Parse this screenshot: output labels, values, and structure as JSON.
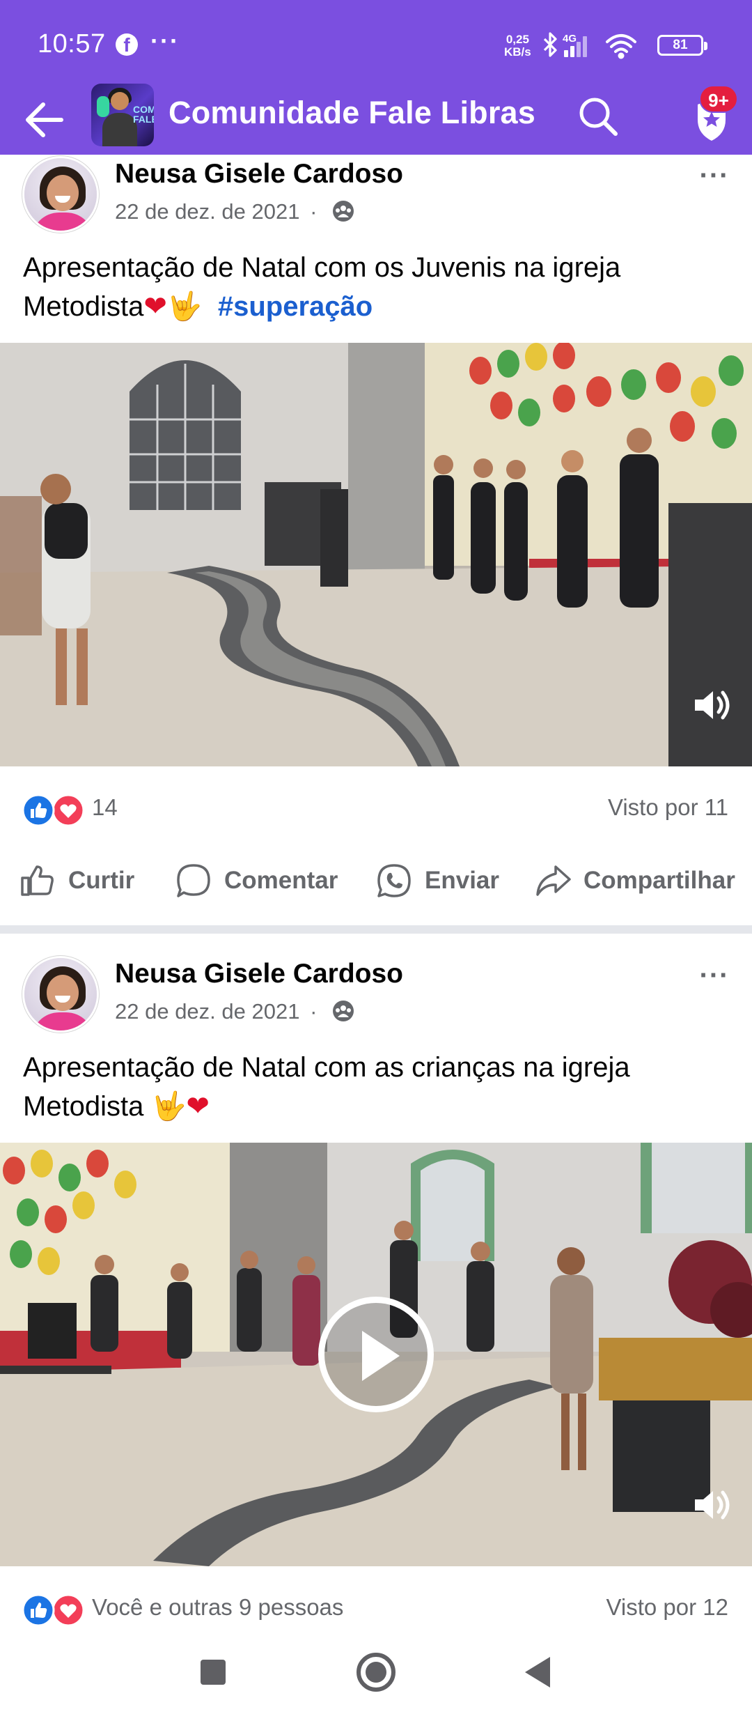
{
  "status_bar": {
    "time": "10:57",
    "notification_app": "f",
    "more": "···",
    "net_speed_value": "0,25",
    "net_speed_unit": "KB/s",
    "network": "4G",
    "battery": "81"
  },
  "app_bar": {
    "title": "Comunidade Fale Libras",
    "thumb_text": "COM FALE",
    "notification_badge": "9+",
    "accent_color": "#7b4fe0"
  },
  "posts": [
    {
      "author": "Neusa Gisele Cardoso",
      "date": "22 de dez. de 2021",
      "separator": "·",
      "more": "···",
      "text": "Apresentação de Natal com os Juvenis na igreja Metodista",
      "text_emoji_1": "❤",
      "text_emoji_2": "🤟",
      "hashtag": "#superação",
      "reaction_count": "14",
      "seen_by": "Visto por 11",
      "media_type": "video"
    },
    {
      "author": "Neusa Gisele Cardoso",
      "date": "22 de dez. de 2021",
      "separator": "·",
      "more": "···",
      "text": "Apresentação de Natal com as crianças na igreja Metodista ",
      "text_emoji_1": "🤟",
      "text_emoji_2": "❤",
      "reaction_summary": "Você e outras 9 pessoas",
      "seen_by": "Visto por 12",
      "media_type": "video"
    }
  ],
  "actions": {
    "like": "Curtir",
    "comment": "Comentar",
    "send": "Enviar",
    "share": "Compartilhar"
  }
}
